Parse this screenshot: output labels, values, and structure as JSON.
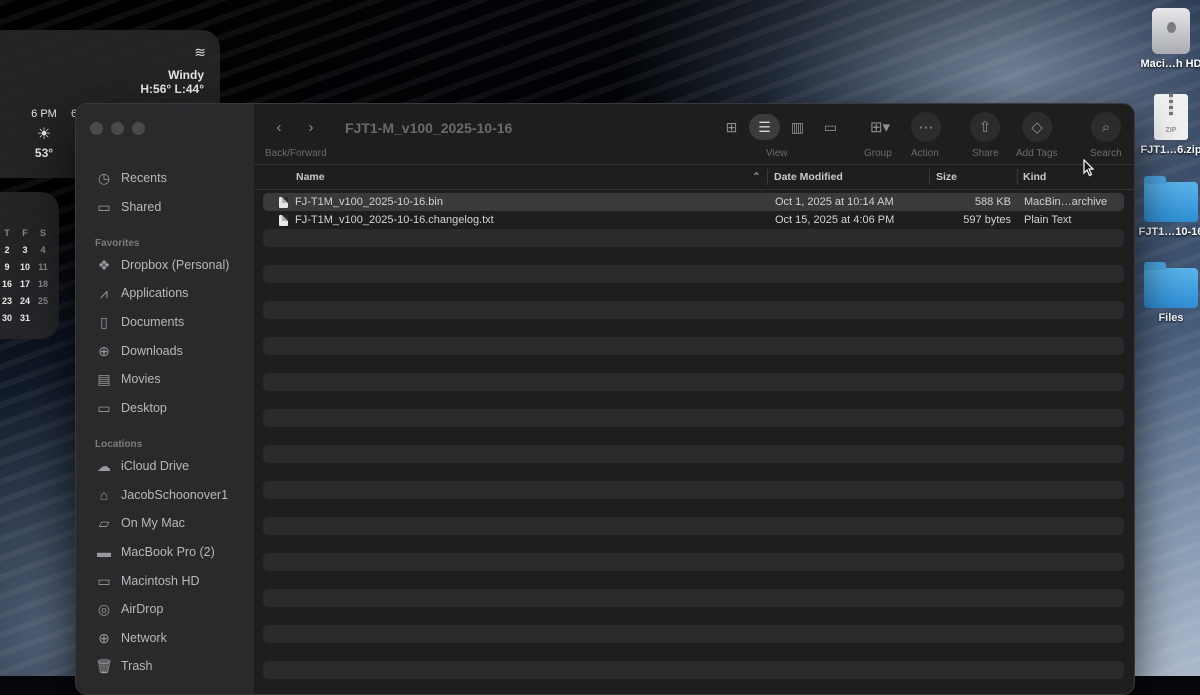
{
  "weather_widget": {
    "wind_icon": "wind-icon",
    "condition": "Windy",
    "high_low": "H:56° L:44°",
    "hour_label": "6 PM",
    "hour_icon": "sun-icon",
    "hour_temp": "53°",
    "next_hour_fragment": "6"
  },
  "calendar_widget": {
    "weekday_headers": [
      "T",
      "F",
      "S"
    ],
    "weeks": [
      [
        "2",
        "3",
        "4"
      ],
      [
        "9",
        "10",
        "11"
      ],
      [
        "16",
        "17",
        "18"
      ],
      [
        "23",
        "24",
        "25"
      ],
      [
        "30",
        "31",
        ""
      ]
    ]
  },
  "desktop_icons": [
    {
      "label": "Maci…h HD",
      "icon": "hard-drive-icon"
    },
    {
      "label": "FJT1…6.zip",
      "icon": "zip-file-icon"
    },
    {
      "label": "FJT1…10-16",
      "icon": "folder-icon"
    },
    {
      "label": "Files",
      "icon": "folder-icon"
    }
  ],
  "finder": {
    "title": "FJT1-M_v100_2025-10-16",
    "toolbar": {
      "back_forward_label": "Back/Forward",
      "view_label": "View",
      "group_label": "Group",
      "action_label": "Action",
      "share_label": "Share",
      "add_tags_label": "Add Tags",
      "search_label": "Search"
    },
    "sidebar": {
      "top_items": [
        {
          "label": "Recents",
          "icon": "clock-icon"
        },
        {
          "label": "Shared",
          "icon": "shared-folder-icon"
        }
      ],
      "favorites_heading": "Favorites",
      "favorites": [
        {
          "label": "Dropbox (Personal)",
          "icon": "dropbox-icon"
        },
        {
          "label": "Applications",
          "icon": "applications-icon"
        },
        {
          "label": "Documents",
          "icon": "document-icon"
        },
        {
          "label": "Downloads",
          "icon": "download-icon"
        },
        {
          "label": "Movies",
          "icon": "film-icon"
        },
        {
          "label": "Desktop",
          "icon": "desktop-icon"
        }
      ],
      "locations_heading": "Locations",
      "locations": [
        {
          "label": "iCloud Drive",
          "icon": "cloud-icon"
        },
        {
          "label": "JacobSchoonover1",
          "icon": "home-icon"
        },
        {
          "label": "On My Mac",
          "icon": "folder-icon"
        },
        {
          "label": "MacBook Pro (2)",
          "icon": "laptop-icon"
        },
        {
          "label": "Macintosh HD",
          "icon": "drive-icon"
        },
        {
          "label": "AirDrop",
          "icon": "airdrop-icon"
        },
        {
          "label": "Network",
          "icon": "globe-icon"
        },
        {
          "label": "Trash",
          "icon": "trash-icon"
        }
      ]
    },
    "columns": {
      "name": "Name",
      "date_modified": "Date Modified",
      "size": "Size",
      "kind": "Kind"
    },
    "files": [
      {
        "name": "FJ-T1M_v100_2025-10-16.bin",
        "date": "Oct 1, 2025 at 10:14 AM",
        "size": "588 KB",
        "kind": "MacBin…archive"
      },
      {
        "name": "FJ-T1M_v100_2025-10-16.changelog.txt",
        "date": "Oct 15, 2025 at 4:06 PM",
        "size": "597 bytes",
        "kind": "Plain Text"
      }
    ]
  }
}
